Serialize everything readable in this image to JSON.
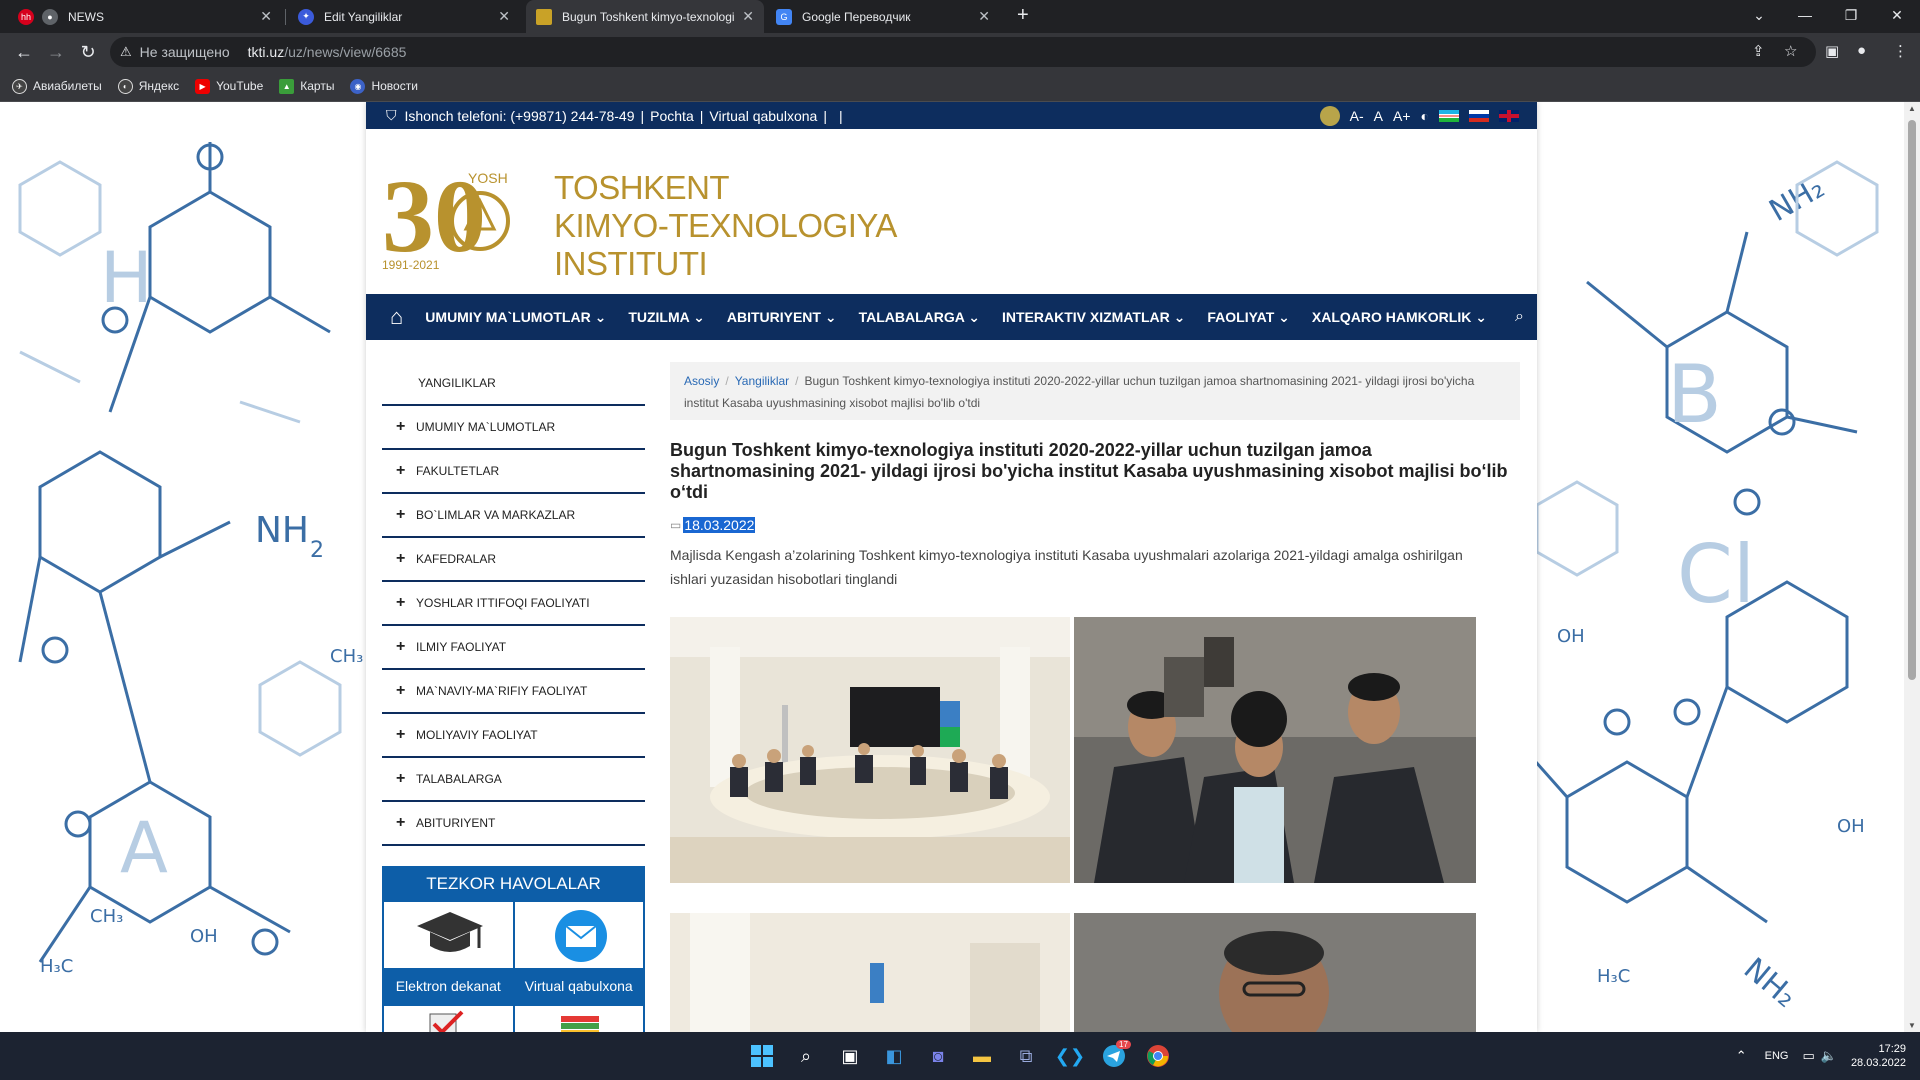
{
  "browser": {
    "tabs": [
      {
        "title": "NEWS",
        "active": false,
        "favicon": "hh-icon"
      },
      {
        "title": "Edit Yangiliklar",
        "active": false,
        "favicon": "edit-icon"
      },
      {
        "title": "Bugun Toshkent kimyo-texnologi",
        "active": true,
        "favicon": "site-icon"
      },
      {
        "title": "Google Переводчик",
        "active": false,
        "favicon": "translate-icon"
      }
    ],
    "address": {
      "security": "Не защищено",
      "domain": "tkti.uz",
      "path": "/uz/news/view/6685"
    },
    "bookmarks": [
      "Авиабилеты",
      "Яндекс",
      "YouTube",
      "Карты",
      "Новости"
    ]
  },
  "site": {
    "topbar": {
      "hotline": "Ishonch telefoni: (+99871) 244-78-49",
      "links": [
        "Pochta",
        "Virtual qabulxona"
      ],
      "font_controls": [
        "A-",
        "A",
        "A+"
      ]
    },
    "logo": {
      "number": "30",
      "yosh": "YOSH",
      "years": "1991-2021",
      "lines": [
        "TOSHKENT",
        "KIMYO-TEXNOLOGIYA",
        "INSTITUTI"
      ]
    },
    "nav": [
      "UMUMIY MA`LUMOTLAR",
      "TUZILMA",
      "ABITURIYENT",
      "TALABALARGA",
      "INTERAKTIV XIZMATLAR",
      "FAOLIYAT",
      "XALQARO HAMKORLIK"
    ],
    "sidebar": {
      "first": "YANGILIKLAR",
      "items": [
        "UMUMIY MA`LUMOTLAR",
        "FAKULTETLAR",
        "BO`LIMLAR VA MARKAZLAR",
        "KAFEDRALAR",
        "YOSHLAR ITTIFOQI FAOLIYATI",
        "ILMIY FAOLIYAT",
        "MA`NAVIY-MA`RIFIY FAOLIYAT",
        "MOLIYAVIY FAOLIYAT",
        "TALABALARGA",
        "ABITURIYENT"
      ]
    },
    "tezkor": {
      "heading": "TEZKOR HAVOLALAR",
      "links": [
        "Elektron dekanat",
        "Virtual qabulxona"
      ]
    },
    "breadcrumb": {
      "home": "Asosiy",
      "section": "Yangiliklar",
      "current": "Bugun Toshkent kimyo-texnologiya instituti 2020-2022-yillar uchun tuzilgan jamoa shartnomasining 2021- yildagi ijrosi bo'yicha institut Kasaba uyushmasining xisobot majlisi bo'lib o'tdi"
    },
    "article": {
      "title": "Bugun Toshkent kimyo-texnologiya instituti 2020-2022-yillar uchun tuzilgan jamoa shartnomasining 2021- yildagi ijrosi bo'yicha institut Kasaba uyushmasining xisobot majlisi bo‘lib o‘tdi",
      "date": "18.03.2022",
      "lead": "Majlisda  Kengash a’zolarining  Toshkent kimyo-texnologiya instituti  Kasaba uyushmalari azolariga 2021-yildagi amalga oshirilgan ishlari yuzasidan hisobotlari tinglandi"
    }
  },
  "taskbar": {
    "lang": "ENG",
    "time": "17:29",
    "date": "28.03.2022",
    "telegram_badge": "17"
  },
  "colors": {
    "navy": "#0d2d5e",
    "gold": "#b8922e",
    "link_blue": "#2a6ab5",
    "tezkor_blue": "#0d5ea8"
  }
}
